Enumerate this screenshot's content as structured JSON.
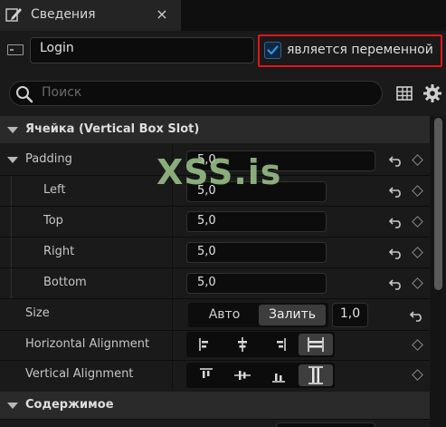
{
  "tab": {
    "title": "Сведения",
    "close_glyph": "×",
    "icon": "pencil-icon"
  },
  "widget": {
    "name": "Login",
    "is_variable_label": "является переменной",
    "is_variable_checked": true,
    "highlight_color": "#e3141a"
  },
  "search": {
    "placeholder": "Поиск"
  },
  "sections": {
    "slot": {
      "title": "Ячейка (Vertical Box Slot)"
    },
    "content": {
      "title": "Содержимое"
    }
  },
  "padding": {
    "label": "Padding",
    "value": "5,0",
    "left_label": "Left",
    "left_value": "5,0",
    "top_label": "Top",
    "top_value": "5,0",
    "right_label": "Right",
    "right_value": "5,0",
    "bottom_label": "Bottom",
    "bottom_value": "5,0"
  },
  "size": {
    "label": "Size",
    "options": [
      "Авто",
      "Залить"
    ],
    "selected": "Залить",
    "value": "1,0"
  },
  "halign": {
    "label": "Horizontal Alignment",
    "options": [
      "align-left-icon",
      "align-center-icon",
      "align-right-icon",
      "align-fill-icon"
    ],
    "selected": "align-fill-icon"
  },
  "valign": {
    "label": "Vertical Alignment",
    "options": [
      "align-top-icon",
      "align-middle-icon",
      "align-bottom-icon",
      "align-fill-vertical-icon"
    ],
    "selected": "align-fill-vertical-icon"
  },
  "watermark": {
    "text": "XSS.is"
  },
  "colors": {
    "accent_check": "#3c8ee8",
    "panel_bg": "#1a1a1a",
    "section_bg": "#2a2a2a"
  }
}
